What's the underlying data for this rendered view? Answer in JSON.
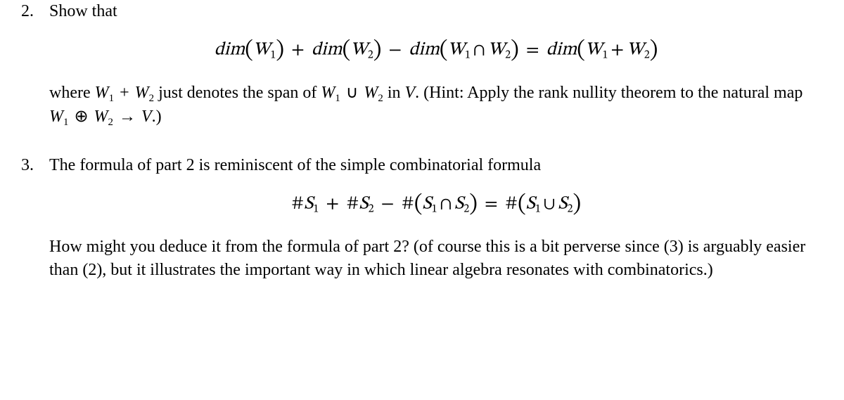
{
  "problems": [
    {
      "number": "2.",
      "intro": "Show that",
      "equation": {
        "lhs_a": "dim",
        "W": "W",
        "sub1": "1",
        "sub2": "2",
        "plus": "+",
        "minus": "−",
        "cap": "∩",
        "cup": "∪",
        "eq": "="
      },
      "where_pre": "where ",
      "where_mid1": " just denotes the span of ",
      "where_mid2": " in ",
      "V": "V",
      "where_post": ". (Hint: Apply the rank nullity theorem to the natural map ",
      "oplus": "⊕",
      "arrow": "→",
      "where_end": ".)"
    },
    {
      "number": "3.",
      "intro": "The formula of part 2 is reminiscent of the simple combinatorial formula",
      "hash": "#",
      "S": "S",
      "sub1": "1",
      "sub2": "2",
      "plus": "+",
      "minus": "−",
      "cap": "∩",
      "cup": "∪",
      "eq": "=",
      "explain": "How might you deduce it from the formula of part 2? (of course this is a bit perverse since (3) is arguably easier than (2), but it illustrates the important way in which linear algebra resonates with combinatorics.)"
    }
  ]
}
